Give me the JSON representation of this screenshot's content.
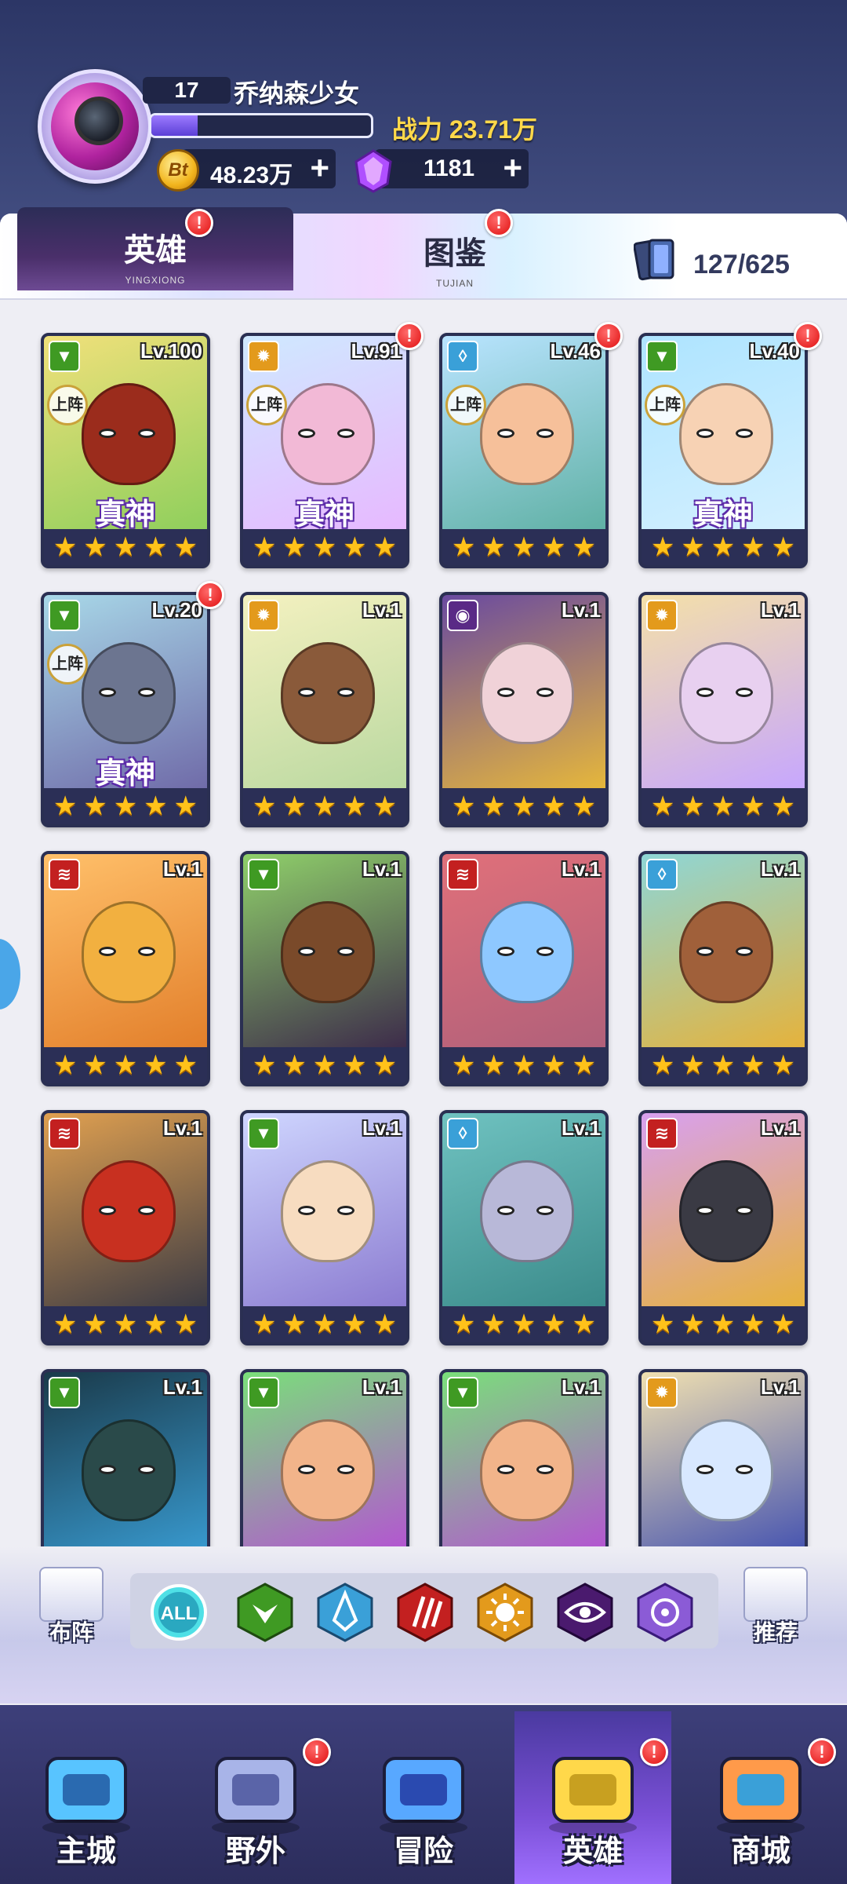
{
  "player": {
    "level": "17",
    "name": "乔纳森少女",
    "exp_fraction": 0.21,
    "power_label": "战力 23.71万",
    "gold": "48.23万",
    "gold_icon_text": "Bt",
    "gems": "1181",
    "plus": "+"
  },
  "tabs": {
    "hero": {
      "label": "英雄",
      "pinyin": "YINGXIONG",
      "badge": "!"
    },
    "book": {
      "label": "图鉴",
      "pinyin": "TUJIAN",
      "badge": "!"
    },
    "collection": "127/625"
  },
  "colors": {
    "nature": "#3f9a23",
    "light": "#e39a1c",
    "water": "#3aa0d8",
    "fire": "#c32020",
    "dark": "#5a2a86",
    "arcane": "#8b5bd6",
    "star": "#ffc21a",
    "active_tab": "#4a2f6a"
  },
  "icons": {
    "nature": "leaf-icon",
    "light": "sun-icon",
    "water": "water-drop-icon",
    "fire": "claw-icon",
    "dark": "dark-eye-icon"
  },
  "labels": {
    "deployed": "上阵",
    "true_god": "真神",
    "star_glyph": "★"
  },
  "heroes": [
    {
      "level": "Lv.100",
      "element": "nature",
      "deployed": true,
      "god": true,
      "alert": false,
      "art": [
        "#f0e07a",
        "#8ecf5c"
      ],
      "skin": "#9b2c1c"
    },
    {
      "level": "Lv.91",
      "element": "light",
      "deployed": true,
      "god": true,
      "alert": true,
      "art": [
        "#cfe9ff",
        "#e7b8ff"
      ],
      "skin": "#f2b9d6"
    },
    {
      "level": "Lv.46",
      "element": "water",
      "deployed": true,
      "god": false,
      "alert": true,
      "art": [
        "#b9e4ff",
        "#5fb0a4"
      ],
      "skin": "#f6c09a"
    },
    {
      "level": "Lv.40",
      "element": "nature",
      "deployed": true,
      "god": true,
      "alert": true,
      "art": [
        "#aee4ff",
        "#d4f0ff"
      ],
      "skin": "#f7d2b4"
    },
    {
      "level": "Lv.20",
      "element": "nature",
      "deployed": true,
      "god": true,
      "alert": true,
      "art": [
        "#a8d8e8",
        "#6f6aa8"
      ],
      "skin": "#6c7590"
    },
    {
      "level": "Lv.1",
      "element": "light",
      "deployed": false,
      "god": false,
      "alert": false,
      "art": [
        "#f4f1c0",
        "#b9d8a0"
      ],
      "skin": "#8a5a3a"
    },
    {
      "level": "Lv.1",
      "element": "dark",
      "deployed": false,
      "god": false,
      "alert": false,
      "art": [
        "#6a4aa0",
        "#e7b83a"
      ],
      "skin": "#f0d2d8"
    },
    {
      "level": "Lv.1",
      "element": "light",
      "deployed": false,
      "god": false,
      "alert": false,
      "art": [
        "#f4e0a8",
        "#c6a6ff"
      ],
      "skin": "#e8d0f0"
    },
    {
      "level": "Lv.1",
      "element": "fire",
      "deployed": false,
      "god": false,
      "alert": false,
      "art": [
        "#ffc06a",
        "#e27e2a"
      ],
      "skin": "#f2b040"
    },
    {
      "level": "Lv.1",
      "element": "nature",
      "deployed": false,
      "god": false,
      "alert": false,
      "art": [
        "#8fd06a",
        "#3c2a4a"
      ],
      "skin": "#7a4a2a"
    },
    {
      "level": "Lv.1",
      "element": "fire",
      "deployed": false,
      "god": false,
      "alert": false,
      "art": [
        "#e0707a",
        "#b0607a"
      ],
      "skin": "#8ec8ff"
    },
    {
      "level": "Lv.1",
      "element": "water",
      "deployed": false,
      "god": false,
      "alert": false,
      "art": [
        "#8ed6d6",
        "#e6b23a"
      ],
      "skin": "#a0603a"
    },
    {
      "level": "Lv.1",
      "element": "fire",
      "deployed": false,
      "god": false,
      "alert": false,
      "art": [
        "#e0a050",
        "#3a3a44"
      ],
      "skin": "#c83020"
    },
    {
      "level": "Lv.1",
      "element": "nature",
      "deployed": false,
      "god": false,
      "alert": false,
      "art": [
        "#cfd6ff",
        "#8a7ad0"
      ],
      "skin": "#f7dcc0"
    },
    {
      "level": "Lv.1",
      "element": "water",
      "deployed": false,
      "god": false,
      "alert": false,
      "art": [
        "#6fc2c0",
        "#3a8a8a"
      ],
      "skin": "#b8b8d8"
    },
    {
      "level": "Lv.1",
      "element": "fire",
      "deployed": false,
      "god": false,
      "alert": false,
      "art": [
        "#d8a0f0",
        "#e6b23a"
      ],
      "skin": "#3a3a44"
    },
    {
      "level": "Lv.1",
      "element": "nature",
      "deployed": false,
      "god": false,
      "alert": false,
      "art": [
        "#1a3a4a",
        "#3aa0d8"
      ],
      "skin": "#2a4a4a"
    },
    {
      "level": "Lv.1",
      "element": "nature",
      "deployed": false,
      "god": false,
      "alert": false,
      "art": [
        "#7adf7a",
        "#b84ad8"
      ],
      "skin": "#f2b48a"
    },
    {
      "level": "Lv.1",
      "element": "nature",
      "deployed": false,
      "god": false,
      "alert": false,
      "art": [
        "#7adf7a",
        "#b84ad8"
      ],
      "skin": "#f2b48a"
    },
    {
      "level": "Lv.1",
      "element": "light",
      "deployed": false,
      "god": false,
      "alert": false,
      "art": [
        "#f0e0b0",
        "#3a4ab0"
      ],
      "skin": "#d8e8ff"
    }
  ],
  "filters": {
    "left": "布阵",
    "right": "推荐",
    "all": "ALL"
  },
  "nav": [
    {
      "label": "主城",
      "icon": "city-icon",
      "alert": false,
      "active": false
    },
    {
      "label": "野外",
      "icon": "wild-icon",
      "alert": true,
      "active": false
    },
    {
      "label": "冒险",
      "icon": "adventure-icon",
      "alert": false,
      "active": false
    },
    {
      "label": "英雄",
      "icon": "hero-icon",
      "alert": true,
      "active": true
    },
    {
      "label": "商城",
      "icon": "shop-icon",
      "alert": true,
      "active": false
    }
  ]
}
